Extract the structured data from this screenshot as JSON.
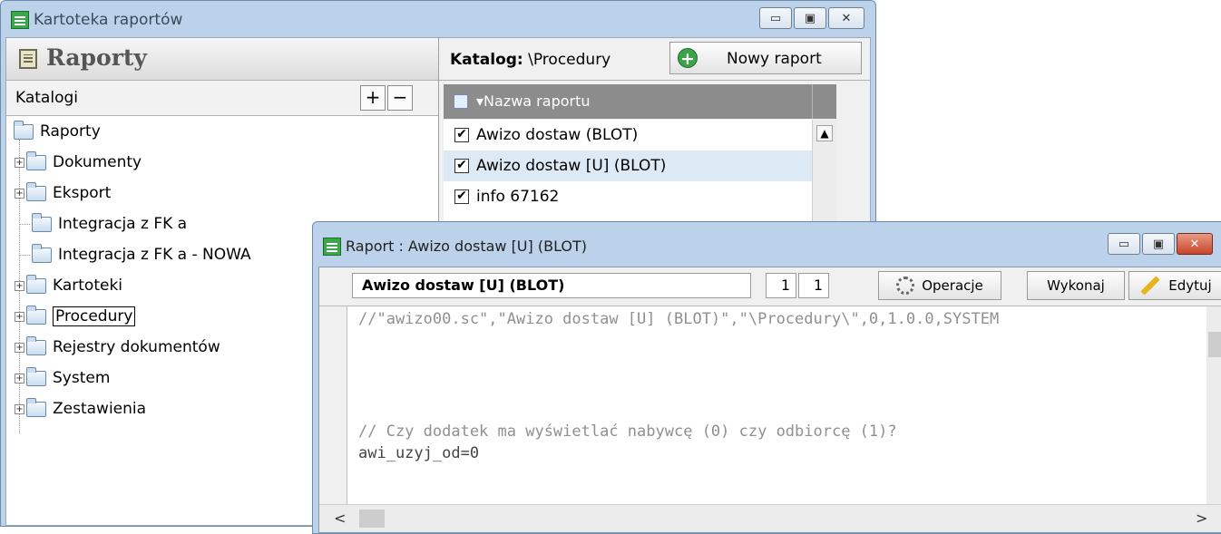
{
  "main_window": {
    "title": "Kartoteka raportów",
    "controls": {
      "minimize": "▭",
      "maximize": "▣",
      "close": "✕"
    },
    "left_pane": {
      "header": "Raporty",
      "catalogs_label": "Katalogi",
      "add_label": "+",
      "remove_label": "−",
      "tree": [
        {
          "label": "Raporty"
        },
        {
          "label": "Dokumenty"
        },
        {
          "label": "Eksport"
        },
        {
          "label": "Integracja z FK a"
        },
        {
          "label": "Integracja z FK a - NOWA"
        },
        {
          "label": "Kartoteki"
        },
        {
          "label": "Procedury"
        },
        {
          "label": "Rejestry dokumentów"
        },
        {
          "label": "System"
        },
        {
          "label": "Zestawienia"
        }
      ]
    },
    "right_pane": {
      "catalog_label": "Katalog:",
      "catalog_path": "\\Procedury",
      "new_report_button": "Nowy raport",
      "column_header": "▾Nazwa raportu",
      "reports": [
        {
          "name": "Awizo dostaw (BLOT)",
          "checked": true
        },
        {
          "name": "Awizo dostaw [U] (BLOT)",
          "checked": true
        },
        {
          "name": "info 67162",
          "checked": true
        }
      ]
    }
  },
  "report_window": {
    "title": "Raport : Awizo dostaw [U] (BLOT)",
    "controls": {
      "minimize": "▭",
      "maximize": "▣",
      "close": "✕"
    },
    "name_field": "Awizo dostaw [U] (BLOT)",
    "counter_a": "1",
    "counter_b": "1",
    "operations_button": "Operacje",
    "execute_button": "Wykonaj",
    "edit_button": "Edytuj",
    "code_lines": [
      "//\"awizo00.sc\",\"Awizo dostaw [U] (BLOT)\",\"\\Procedury\\\",0,1.0.0,SYSTEM",
      "// Czy dodatek ma wyświetlać nabywcę (0) czy odbiorcę (1)?",
      "awi_uzyj_od=0"
    ],
    "scroll_left": "<",
    "scroll_right": ">"
  }
}
